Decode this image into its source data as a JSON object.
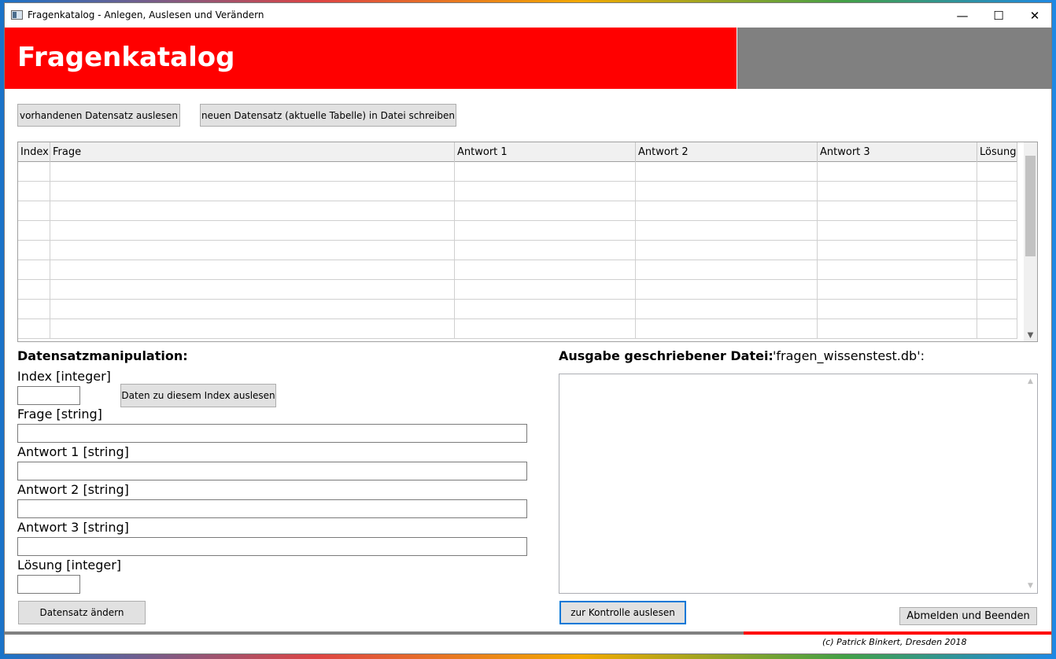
{
  "window": {
    "title": "Fragenkatalog - Anlegen, Auslesen und Verändern",
    "minimize_glyph": "—",
    "maximize_glyph": "☐",
    "close_glyph": "✕"
  },
  "header": {
    "title": "Fragenkatalog",
    "left_color": "#ff0000",
    "right_color": "#808080"
  },
  "toolbar": {
    "read_button": "vorhandenen Datensatz auslesen",
    "write_button": "neuen Datensatz (aktuelle Tabelle) in Datei schreiben"
  },
  "table": {
    "columns": [
      "Index",
      "Frage",
      "Antwort 1",
      "Antwort 2",
      "Antwort 3",
      "Lösung"
    ],
    "rows": [
      [
        "",
        "",
        "",
        "",
        "",
        ""
      ],
      [
        "",
        "",
        "",
        "",
        "",
        ""
      ],
      [
        "",
        "",
        "",
        "",
        "",
        ""
      ],
      [
        "",
        "",
        "",
        "",
        "",
        ""
      ],
      [
        "",
        "",
        "",
        "",
        "",
        ""
      ],
      [
        "",
        "",
        "",
        "",
        "",
        ""
      ],
      [
        "",
        "",
        "",
        "",
        "",
        ""
      ],
      [
        "",
        "",
        "",
        "",
        "",
        ""
      ],
      [
        "",
        "",
        "",
        "",
        "",
        ""
      ]
    ]
  },
  "manipulation": {
    "heading": "Datensatzmanipulation:",
    "index_label": "Index [integer]",
    "index_value": "",
    "read_index_button": "Daten zu diesem Index auslesen",
    "frage_label": "Frage [string]",
    "frage_value": "",
    "antwort1_label": "Antwort 1 [string]",
    "antwort1_value": "",
    "antwort2_label": "Antwort 2 [string]",
    "antwort2_value": "",
    "antwort3_label": "Antwort 3 [string]",
    "antwort3_value": "",
    "loesung_label": "Lösung [integer]",
    "loesung_value": "",
    "change_button": "Datensatz ändern"
  },
  "output": {
    "heading": "Ausgabe geschriebener Datei:",
    "filename": "'fragen_wissenstest.db':",
    "content": "",
    "control_button": "zur Kontrolle auslesen",
    "exit_button": "Abmelden und Beenden"
  },
  "footer": {
    "copyright": "(c) Patrick Binkert, Dresden 2018"
  }
}
